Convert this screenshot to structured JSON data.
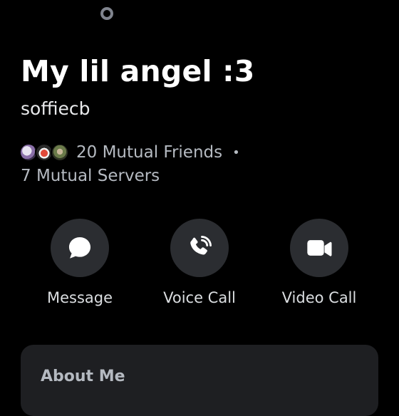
{
  "profile": {
    "display_name": "My lil angel :3",
    "username": "soffiecb",
    "status": "offline",
    "status_color": "#80848e"
  },
  "mutuals": {
    "friends_label": "20 Mutual Friends",
    "separator": "•",
    "servers_label": "7 Mutual Servers"
  },
  "actions": [
    {
      "label": "Message",
      "icon": "chat-bubble-icon"
    },
    {
      "label": "Voice Call",
      "icon": "phone-icon"
    },
    {
      "label": "Video Call",
      "icon": "video-camera-icon"
    }
  ],
  "about": {
    "title": "About Me"
  },
  "colors": {
    "background": "#000000",
    "button_bg": "#2b2d31",
    "card_bg": "#1e1f22",
    "muted_text": "#b5bac1"
  }
}
